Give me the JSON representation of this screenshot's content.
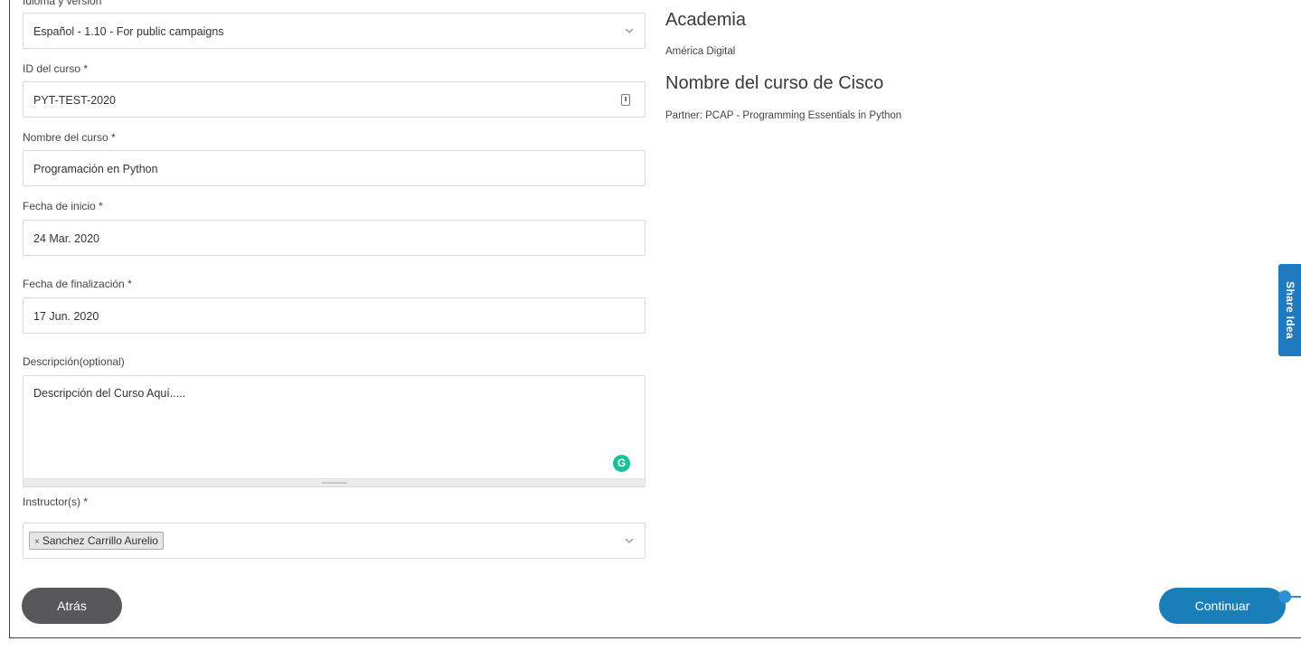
{
  "form": {
    "language": {
      "label": "Idioma y versión",
      "value": "Español - 1.10 - For public campaigns"
    },
    "course_id": {
      "label": "ID del curso *",
      "value": "PYT-TEST-2020"
    },
    "course_name": {
      "label": "Nombre del curso *",
      "value": "Programación en Python"
    },
    "start_date": {
      "label": "Fecha de inicio *",
      "value": "24 Mar. 2020"
    },
    "end_date": {
      "label": "Fecha de finalización *",
      "value": "17 Jun. 2020"
    },
    "description": {
      "label": "Descripción(optional)",
      "value": "Descripción del Curso Aquí....."
    },
    "instructors": {
      "label": "Instructor(s) *",
      "tag_remove": "×",
      "tags": [
        "Sanchez Carrillo Aurelio"
      ]
    }
  },
  "summary": {
    "academy_heading": "Academia",
    "academy_name": "América Digital",
    "course_heading": "Nombre del curso de Cisco",
    "partner": "Partner: PCAP - Programming Essentials in Python"
  },
  "buttons": {
    "back": "Atrás",
    "continue": "Continuar"
  },
  "share_idea": "Share Idea",
  "grammarly_letter": "G",
  "colors": {
    "primary": "#1a7fb8",
    "back_button": "#58585a",
    "share_tab": "#1f7ac0",
    "grammarly": "#15c39a"
  },
  "icons": {
    "dropdown": "chevron-down-icon",
    "id_field": "id-card-icon",
    "grammarly": "grammarly-icon",
    "tag_remove": "close-icon"
  }
}
